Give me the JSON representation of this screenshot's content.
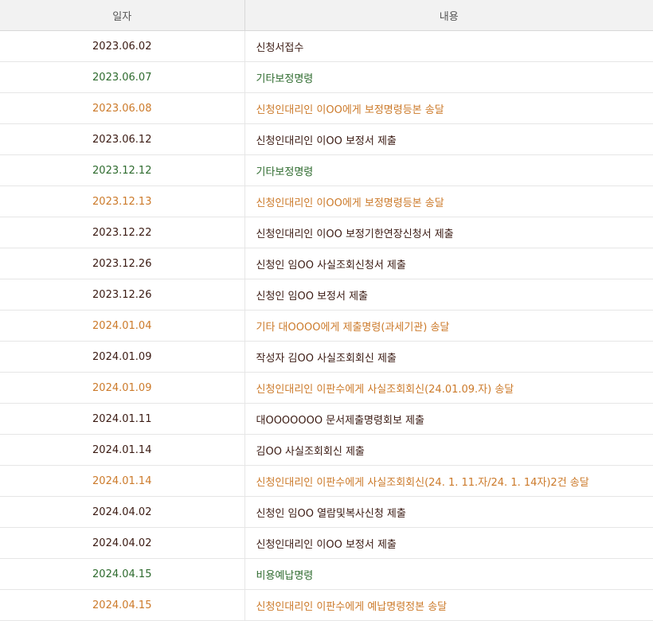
{
  "header": {
    "date": "일자",
    "content": "내용"
  },
  "colors": {
    "default": "#3a1a12",
    "order": "#2e6b2e",
    "delivery": "#cc7a2a"
  },
  "rows": [
    {
      "date": "2023.06.02",
      "content": "신청서접수",
      "status": "default"
    },
    {
      "date": "2023.06.07",
      "content": "기타보정명령",
      "status": "order"
    },
    {
      "date": "2023.06.08",
      "content": "신청인대리인 이OO에게 보정명령등본 송달",
      "status": "delivery"
    },
    {
      "date": "2023.06.12",
      "content": "신청인대리인 이OO 보정서 제출",
      "status": "default"
    },
    {
      "date": "2023.12.12",
      "content": "기타보정명령",
      "status": "order"
    },
    {
      "date": "2023.12.13",
      "content": "신청인대리인 이OO에게 보정명령등본 송달",
      "status": "delivery"
    },
    {
      "date": "2023.12.22",
      "content": "신청인대리인 이OO 보정기한연장신청서 제출",
      "status": "default"
    },
    {
      "date": "2023.12.26",
      "content": "신청인 임OO 사실조회신청서 제출",
      "status": "default"
    },
    {
      "date": "2023.12.26",
      "content": "신청인 임OO 보정서 제출",
      "status": "default"
    },
    {
      "date": "2024.01.04",
      "content": "기타 대OOOO에게 제출명령(과세기관) 송달",
      "status": "delivery"
    },
    {
      "date": "2024.01.09",
      "content": "작성자 김OO 사실조회회신 제출",
      "status": "default"
    },
    {
      "date": "2024.01.09",
      "content": "신청인대리인 이판수에게 사실조회회신(24.01.09.자) 송달",
      "status": "delivery"
    },
    {
      "date": "2024.01.11",
      "content": "대OOOOOOO 문서제출명령회보 제출",
      "status": "default"
    },
    {
      "date": "2024.01.14",
      "content": "김OO 사실조회회신 제출",
      "status": "default"
    },
    {
      "date": "2024.01.14",
      "content": "신청인대리인 이판수에게 사실조회회신(24. 1. 11.자/24. 1. 14자)2건 송달",
      "status": "delivery"
    },
    {
      "date": "2024.04.02",
      "content": "신청인 임OO 열람및복사신청 제출",
      "status": "default"
    },
    {
      "date": "2024.04.02",
      "content": "신청인대리인 이OO 보정서 제출",
      "status": "default"
    },
    {
      "date": "2024.04.15",
      "content": "비용예납명령",
      "status": "order"
    },
    {
      "date": "2024.04.15",
      "content": "신청인대리인 이판수에게 예납명령정본 송달",
      "status": "delivery"
    }
  ]
}
